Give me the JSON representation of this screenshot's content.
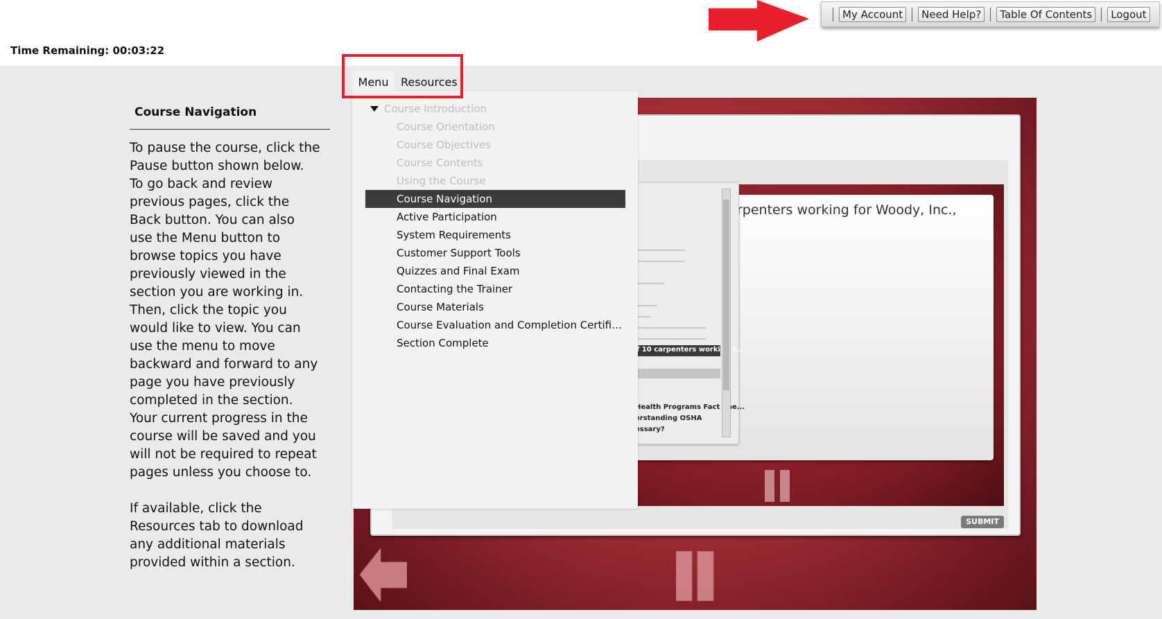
{
  "toolbar": {
    "my_account": "My Account",
    "need_help": "Need Help?",
    "table_of_contents": "Table Of Contents",
    "logout": "Logout"
  },
  "timer": {
    "label": "Time Remaining: 00:03:22"
  },
  "left_panel": {
    "title": "Course Navigation",
    "paragraph1": "To pause the course, click the Pause button shown below. To go back and review previous pages,  click the Back button. You can also use the Menu button to browse topics you have previously viewed in the section you are working in. Then, click the topic you would like to view. You can use the menu to move backward and forward to any page you have previously completed in the section. Your current progress in the course will be saved and you will not be required to repeat pages unless you choose to.",
    "paragraph2": "If available, click the Resources tab to download any additional materials provided within a section."
  },
  "menu": {
    "tabs": [
      {
        "label": "Menu"
      },
      {
        "label": "Resources"
      }
    ],
    "parent": "Course Introduction",
    "items": [
      {
        "label": "Course Orientation"
      },
      {
        "label": "Course Objectives"
      },
      {
        "label": "Course Contents"
      },
      {
        "label": "Using the Course"
      },
      {
        "label": "Course Navigation"
      },
      {
        "label": "Active Participation"
      },
      {
        "label": "System Requirements"
      },
      {
        "label": "Customer Support Tools"
      },
      {
        "label": "Quizzes and Final Exam"
      },
      {
        "label": "Contacting the Trainer"
      },
      {
        "label": "Course Materials"
      },
      {
        "label": "Course Evaluation and Completion Certificate/..."
      },
      {
        "label": "Section Complete"
      }
    ]
  },
  "slide": {
    "question_text": "rpenters working for Woody, Inc.,",
    "submit_label": "SUBMIT",
    "mini_menu_items": [
      {
        "label": "Health Programs Fact She..."
      },
      {
        "label": "erstanding OSHA"
      },
      {
        "label": "essary?"
      },
      {
        "label": "f 10 carpenters working f..."
      }
    ]
  },
  "colors": {
    "callout_red": "#e8202c",
    "player_red": "#9a2a33",
    "menu_highlight": "#3c3c3c"
  }
}
